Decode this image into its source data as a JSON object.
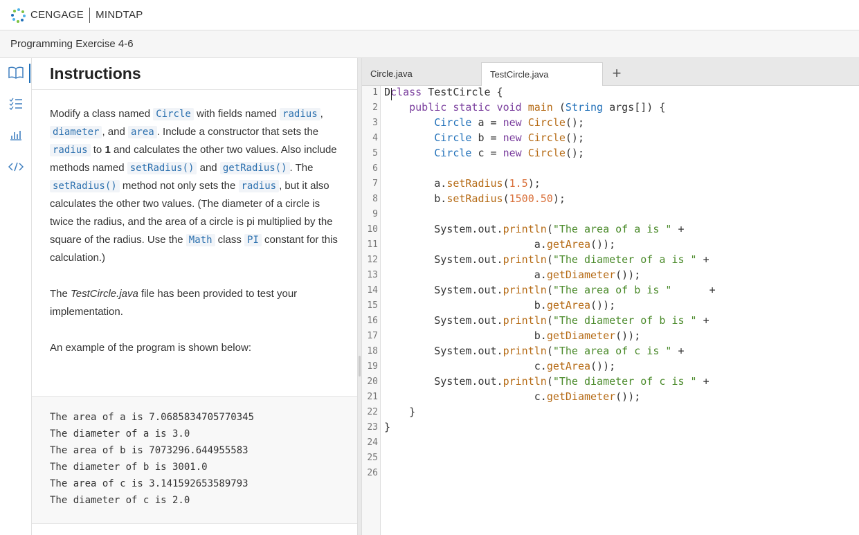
{
  "brand": {
    "left": "CENGAGE",
    "right": "MINDTAP"
  },
  "exercise_title": "Programming Exercise 4-6",
  "rail": {
    "icons": [
      "book-icon",
      "checklist-icon",
      "chart-icon",
      "code-icon"
    ]
  },
  "instructions": {
    "heading": "Instructions",
    "p1": {
      "t1": "Modify a class named ",
      "c_circle": "Circle",
      "t2": " with fields named ",
      "c_radius": "radius",
      "t3": ", ",
      "c_diameter": "diameter",
      "t4": ", and ",
      "c_area": "area",
      "t5": ". Include a constructor that sets the ",
      "c_radius2": "radius",
      "t6": " to ",
      "b_one": "1",
      "t7": " and calculates the other two values. Also include methods named ",
      "c_setradius": "setRadius()",
      "t8": " and ",
      "c_getradius": "getRadius()",
      "t9": ". The ",
      "c_setradius2": "setRadius()",
      "t10": " method not only sets the ",
      "c_radius3": "radius",
      "t11": ", but it also calculates the other two values. (The diameter of a circle is twice the radius, and the area of a circle is pi multiplied by the square of the radius. Use the ",
      "c_math": "Math",
      "t12": " class ",
      "c_pi": "PI",
      "t13": " constant for this calculation.)"
    },
    "p2": {
      "t1": "The ",
      "i_file": "TestCircle.java",
      "t2": " file has been provided to test your implementation."
    },
    "p3": "An example of the program is shown below:",
    "example_lines": [
      "The area of a is 7.0685834705770345",
      "The diameter of a is 3.0",
      "The area of b is 7073296.644955583",
      "The diameter of b is 3001.0",
      "The area of c is 3.141592653589793",
      "The diameter of c is 2.0"
    ]
  },
  "editor": {
    "tabs": [
      "Circle.java",
      "TestCircle.java"
    ],
    "add_tab": "+",
    "line_numbers": [
      "1",
      "2",
      "3",
      "4",
      "5",
      "6",
      "7",
      "8",
      "9",
      "10",
      "11",
      "12",
      "13",
      "14",
      "15",
      "16",
      "17",
      "18",
      "19",
      "20",
      "21",
      "22",
      "23",
      "24",
      "25",
      "26"
    ],
    "code": {
      "l1": {
        "p0": "D",
        "kw": "class",
        "rest": " TestCircle {"
      },
      "l2": {
        "ind": "    ",
        "kw1": "public",
        "sp1": " ",
        "kw2": "static",
        "sp2": " ",
        "kw3": "void",
        "sp3": " ",
        "fn": "main",
        "rest1": " (",
        "ty": "String",
        "rest2": " args[]) {"
      },
      "l3": {
        "ind": "        ",
        "ty": "Circle",
        "mid": " a = ",
        "kw": "new",
        "sp": " ",
        "fn": "Circle",
        "end": "();"
      },
      "l4": {
        "ind": "        ",
        "ty": "Circle",
        "mid": " b = ",
        "kw": "new",
        "sp": " ",
        "fn": "Circle",
        "end": "();"
      },
      "l5": {
        "ind": "        ",
        "ty": "Circle",
        "mid": " c = ",
        "kw": "new",
        "sp": " ",
        "fn": "Circle",
        "end": "();"
      },
      "l7": {
        "ind": "        ",
        "obj": "a.",
        "fn": "setRadius",
        "op": "(",
        "num": "1.5",
        "end": ");"
      },
      "l8": {
        "ind": "        ",
        "obj": "b.",
        "fn": "setRadius",
        "op": "(",
        "num": "1500.50",
        "end": ");"
      },
      "l10": {
        "ind": "        ",
        "obj": "System.out.",
        "fn": "println",
        "op": "(",
        "str": "\"The area of a is \"",
        "end": " +"
      },
      "l11": {
        "ind": "                        ",
        "obj": "a.",
        "fn": "getArea",
        "end": "());"
      },
      "l12": {
        "ind": "        ",
        "obj": "System.out.",
        "fn": "println",
        "op": "(",
        "str": "\"The diameter of a is \"",
        "end": " +"
      },
      "l13": {
        "ind": "                        ",
        "obj": "a.",
        "fn": "getDiameter",
        "end": "());"
      },
      "l14": {
        "ind": "        ",
        "obj": "System.out.",
        "fn": "println",
        "op": "(",
        "str": "\"The area of b is \"",
        "end": "      +"
      },
      "l15": {
        "ind": "                        ",
        "obj": "b.",
        "fn": "getArea",
        "end": "());"
      },
      "l16": {
        "ind": "        ",
        "obj": "System.out.",
        "fn": "println",
        "op": "(",
        "str": "\"The diameter of b is \"",
        "end": " +"
      },
      "l17": {
        "ind": "                        ",
        "obj": "b.",
        "fn": "getDiameter",
        "end": "());"
      },
      "l18": {
        "ind": "        ",
        "obj": "System.out.",
        "fn": "println",
        "op": "(",
        "str": "\"The area of c is \"",
        "end": " +"
      },
      "l19": {
        "ind": "                        ",
        "obj": "c.",
        "fn": "getArea",
        "end": "());"
      },
      "l20": {
        "ind": "        ",
        "obj": "System.out.",
        "fn": "println",
        "op": "(",
        "str": "\"The diameter of c is \"",
        "end": " +"
      },
      "l21": {
        "ind": "                        ",
        "obj": "c.",
        "fn": "getDiameter",
        "end": "());"
      },
      "l22": "    }",
      "l23": "}"
    }
  },
  "colors": {
    "accent": "#1f6fb8",
    "keyword": "#7a3e9d",
    "string": "#4a8a2a",
    "number": "#d9703a",
    "method": "#b56a14"
  }
}
